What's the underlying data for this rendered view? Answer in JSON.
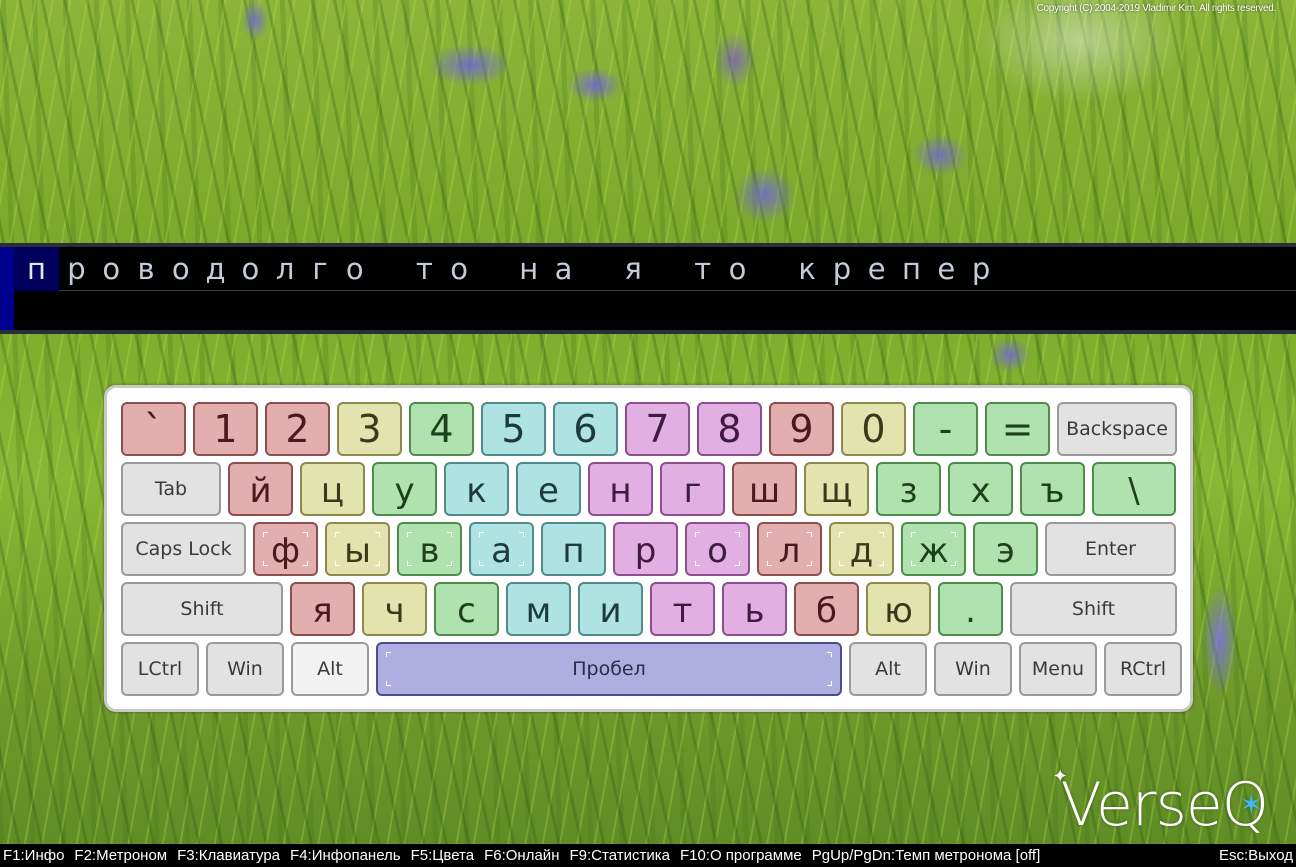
{
  "copyright": "Copyright (C) 2004-2019 Vladimir Kim. All rights reserved.",
  "typing": {
    "text": "проводолго то на я то крепер",
    "current_index": 0,
    "input": ""
  },
  "keyboard": {
    "rows": [
      [
        {
          "label": "`",
          "color": "red",
          "type": "digit"
        },
        {
          "label": "1",
          "color": "red",
          "type": "digit"
        },
        {
          "label": "2",
          "color": "red",
          "type": "digit"
        },
        {
          "label": "3",
          "color": "yellow",
          "type": "digit"
        },
        {
          "label": "4",
          "color": "green",
          "type": "digit"
        },
        {
          "label": "5",
          "color": "cyan",
          "type": "digit"
        },
        {
          "label": "6",
          "color": "cyan",
          "type": "digit"
        },
        {
          "label": "7",
          "color": "pink",
          "type": "digit"
        },
        {
          "label": "8",
          "color": "pink",
          "type": "digit"
        },
        {
          "label": "9",
          "color": "red",
          "type": "digit"
        },
        {
          "label": "0",
          "color": "yellow",
          "type": "digit"
        },
        {
          "label": "-",
          "color": "green",
          "type": "digit"
        },
        {
          "label": "=",
          "color": "green",
          "type": "digit"
        },
        {
          "label": "Backspace",
          "color": "func",
          "type": "func"
        }
      ],
      [
        {
          "label": "Tab",
          "color": "func",
          "type": "func"
        },
        {
          "label": "й",
          "color": "red",
          "type": "char"
        },
        {
          "label": "ц",
          "color": "yellow",
          "type": "char"
        },
        {
          "label": "у",
          "color": "green",
          "type": "char"
        },
        {
          "label": "к",
          "color": "cyan",
          "type": "char"
        },
        {
          "label": "е",
          "color": "cyan",
          "type": "char"
        },
        {
          "label": "н",
          "color": "pink",
          "type": "char"
        },
        {
          "label": "г",
          "color": "pink",
          "type": "char"
        },
        {
          "label": "ш",
          "color": "red",
          "type": "char"
        },
        {
          "label": "щ",
          "color": "yellow",
          "type": "char"
        },
        {
          "label": "з",
          "color": "green",
          "type": "char"
        },
        {
          "label": "х",
          "color": "green",
          "type": "char"
        },
        {
          "label": "ъ",
          "color": "green",
          "type": "char"
        },
        {
          "label": "\\",
          "color": "green",
          "type": "char"
        }
      ],
      [
        {
          "label": "Caps Lock",
          "color": "func",
          "type": "func"
        },
        {
          "label": "ф",
          "color": "red",
          "type": "char",
          "home": true
        },
        {
          "label": "ы",
          "color": "yellow",
          "type": "char",
          "home": true
        },
        {
          "label": "в",
          "color": "green",
          "type": "char",
          "home": true
        },
        {
          "label": "а",
          "color": "cyan",
          "type": "char",
          "home": true
        },
        {
          "label": "п",
          "color": "cyan",
          "type": "char"
        },
        {
          "label": "р",
          "color": "pink",
          "type": "char"
        },
        {
          "label": "о",
          "color": "pink",
          "type": "char",
          "home": true
        },
        {
          "label": "л",
          "color": "red",
          "type": "char",
          "home": true
        },
        {
          "label": "д",
          "color": "yellow",
          "type": "char",
          "home": true
        },
        {
          "label": "ж",
          "color": "green",
          "type": "char",
          "home": true
        },
        {
          "label": "э",
          "color": "green",
          "type": "char"
        },
        {
          "label": "Enter",
          "color": "func",
          "type": "func"
        }
      ],
      [
        {
          "label": "Shift",
          "color": "func",
          "type": "func"
        },
        {
          "label": "я",
          "color": "red",
          "type": "char"
        },
        {
          "label": "ч",
          "color": "yellow",
          "type": "char"
        },
        {
          "label": "с",
          "color": "green",
          "type": "char"
        },
        {
          "label": "м",
          "color": "cyan",
          "type": "char"
        },
        {
          "label": "и",
          "color": "cyan",
          "type": "char"
        },
        {
          "label": "т",
          "color": "pink",
          "type": "char"
        },
        {
          "label": "ь",
          "color": "pink",
          "type": "char"
        },
        {
          "label": "б",
          "color": "red",
          "type": "char"
        },
        {
          "label": "ю",
          "color": "yellow",
          "type": "char"
        },
        {
          "label": ".",
          "color": "green",
          "type": "char"
        },
        {
          "label": "Shift",
          "color": "func",
          "type": "func"
        }
      ],
      [
        {
          "label": "LCtrl",
          "color": "func",
          "type": "func"
        },
        {
          "label": "Win",
          "color": "func",
          "type": "func"
        },
        {
          "label": "Alt",
          "color": "func-light",
          "type": "func"
        },
        {
          "label": "Пробел",
          "color": "space",
          "type": "space"
        },
        {
          "label": "Alt",
          "color": "func",
          "type": "func"
        },
        {
          "label": "Win",
          "color": "func",
          "type": "func"
        },
        {
          "label": "Menu",
          "color": "func",
          "type": "func"
        },
        {
          "label": "RCtrl",
          "color": "func",
          "type": "func"
        }
      ]
    ]
  },
  "logo": {
    "text": "VerseQ"
  },
  "status_bar": {
    "hotkeys": [
      "F1:Инфо",
      "F2:Метроном",
      "F3:Клавиатура",
      "F4:Инфопанель",
      "F5:Цвета",
      "F6:Онлайн",
      "F9:Статистика",
      "F10:О программе",
      "PgUp/PgDn:Темп метронома [off]"
    ],
    "exit": "Esc:Выход"
  }
}
